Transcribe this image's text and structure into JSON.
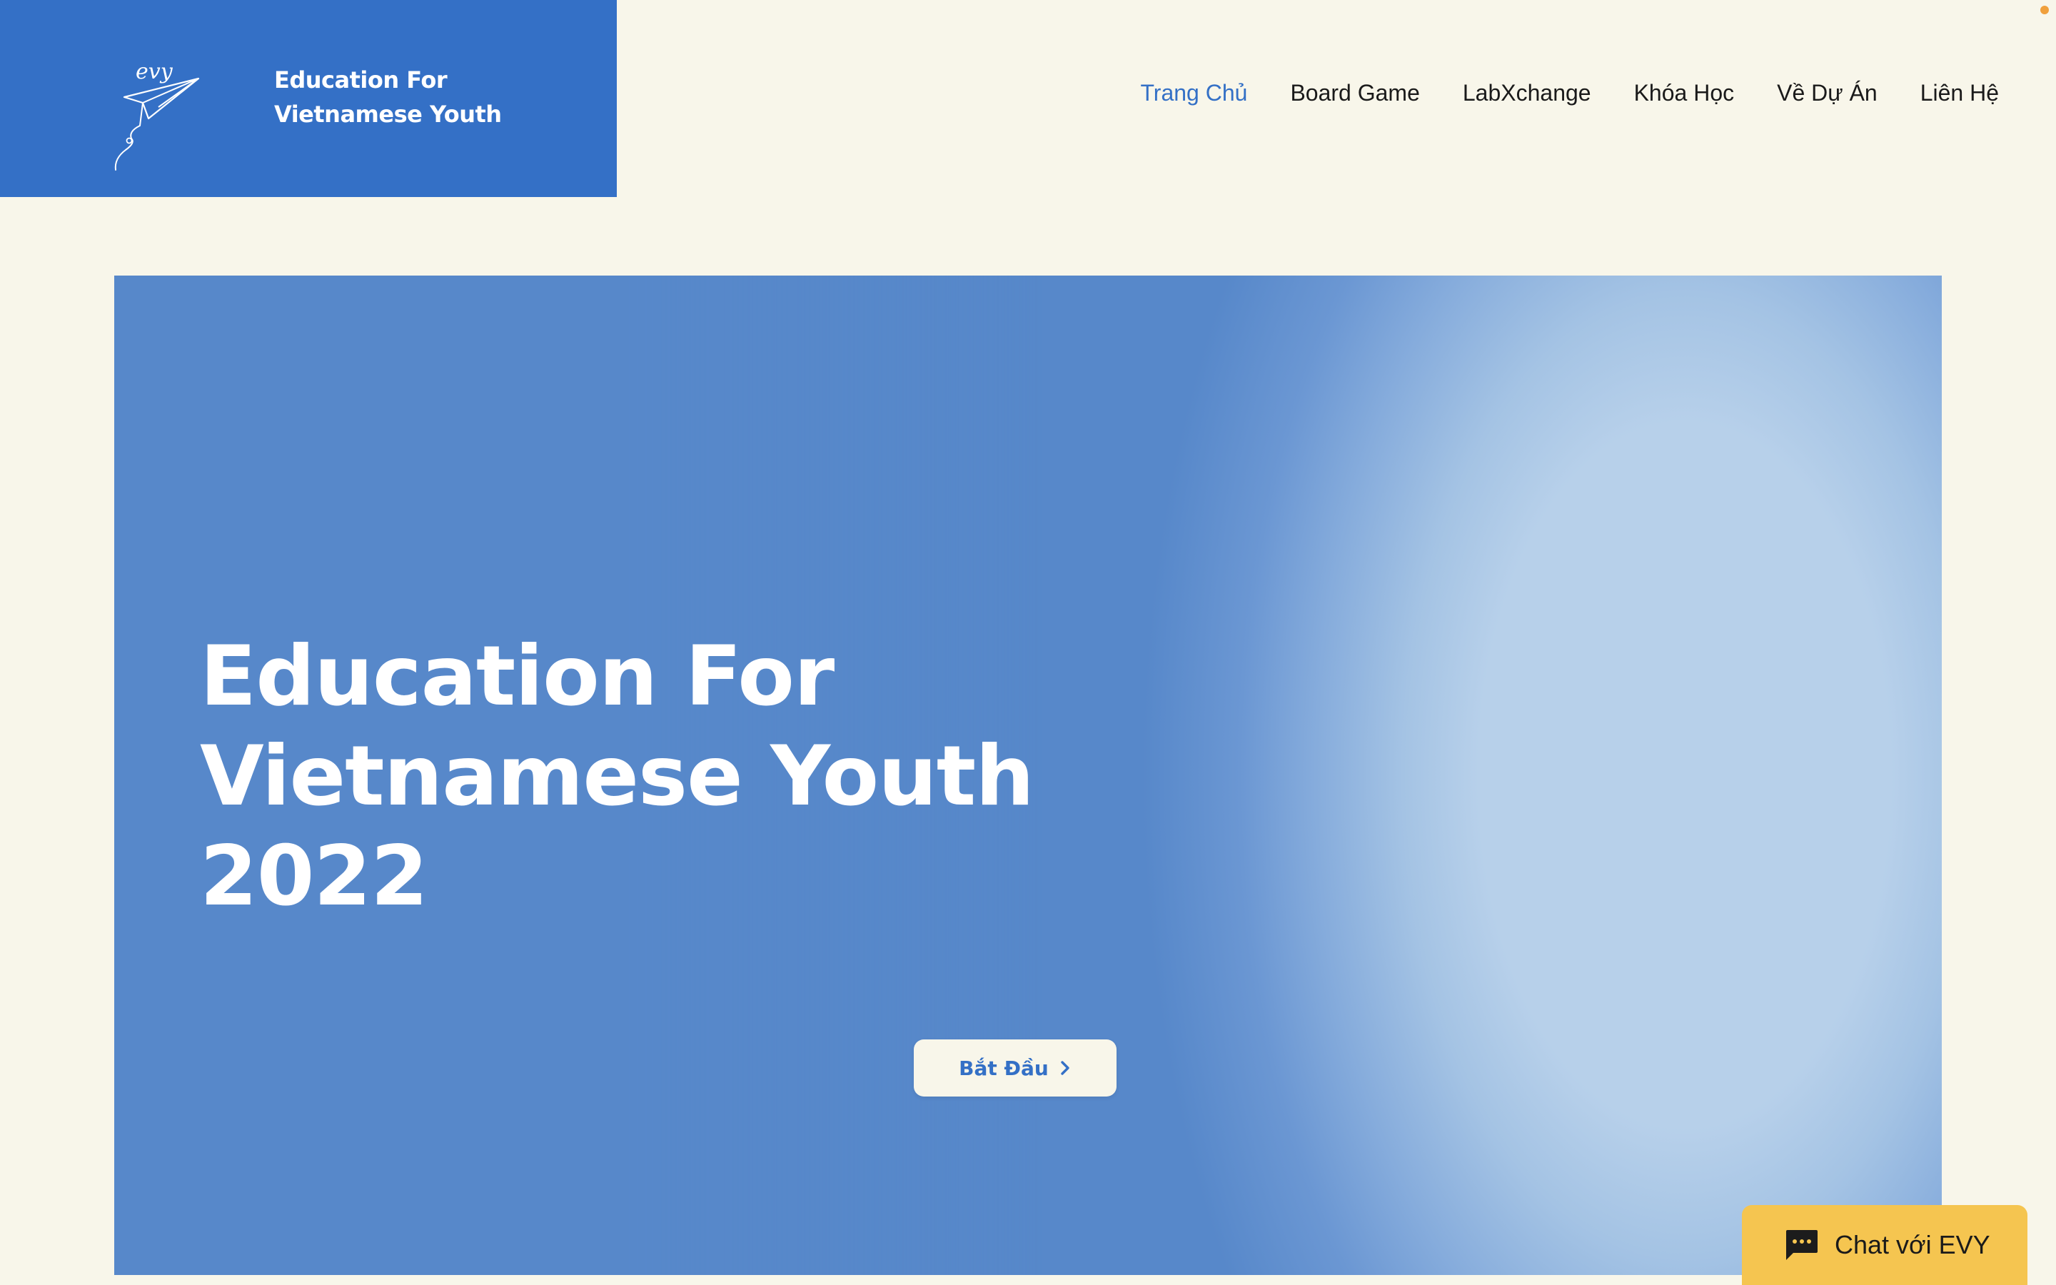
{
  "brand": {
    "line1": "Education For",
    "line2": "Vietnamese Youth",
    "logo_lettering": "evy",
    "logo_icon": "paper-plane-icon",
    "color": "#3470c6"
  },
  "nav": {
    "items": [
      {
        "label": "Trang Chủ",
        "active": true
      },
      {
        "label": "Board Game",
        "active": false
      },
      {
        "label": "LabXchange",
        "active": false
      },
      {
        "label": "Khóa Học",
        "active": false
      },
      {
        "label": "Về Dự Án",
        "active": false
      },
      {
        "label": "Liên Hệ",
        "active": false
      }
    ],
    "active_color": "#3470c6"
  },
  "hero": {
    "title_line1": "Education For",
    "title_line2": "Vietnamese Youth",
    "title_line3": "2022",
    "button_label": "Bắt Đầu",
    "button_icon": "chevron-right-icon",
    "colors": {
      "primary": "#5788ca",
      "light": "#b7d0ea"
    }
  },
  "chat": {
    "label": "Chat với EVY",
    "icon": "chat-bubble-icon",
    "color": "#f5c550"
  },
  "page_background": "#f8f6ea"
}
